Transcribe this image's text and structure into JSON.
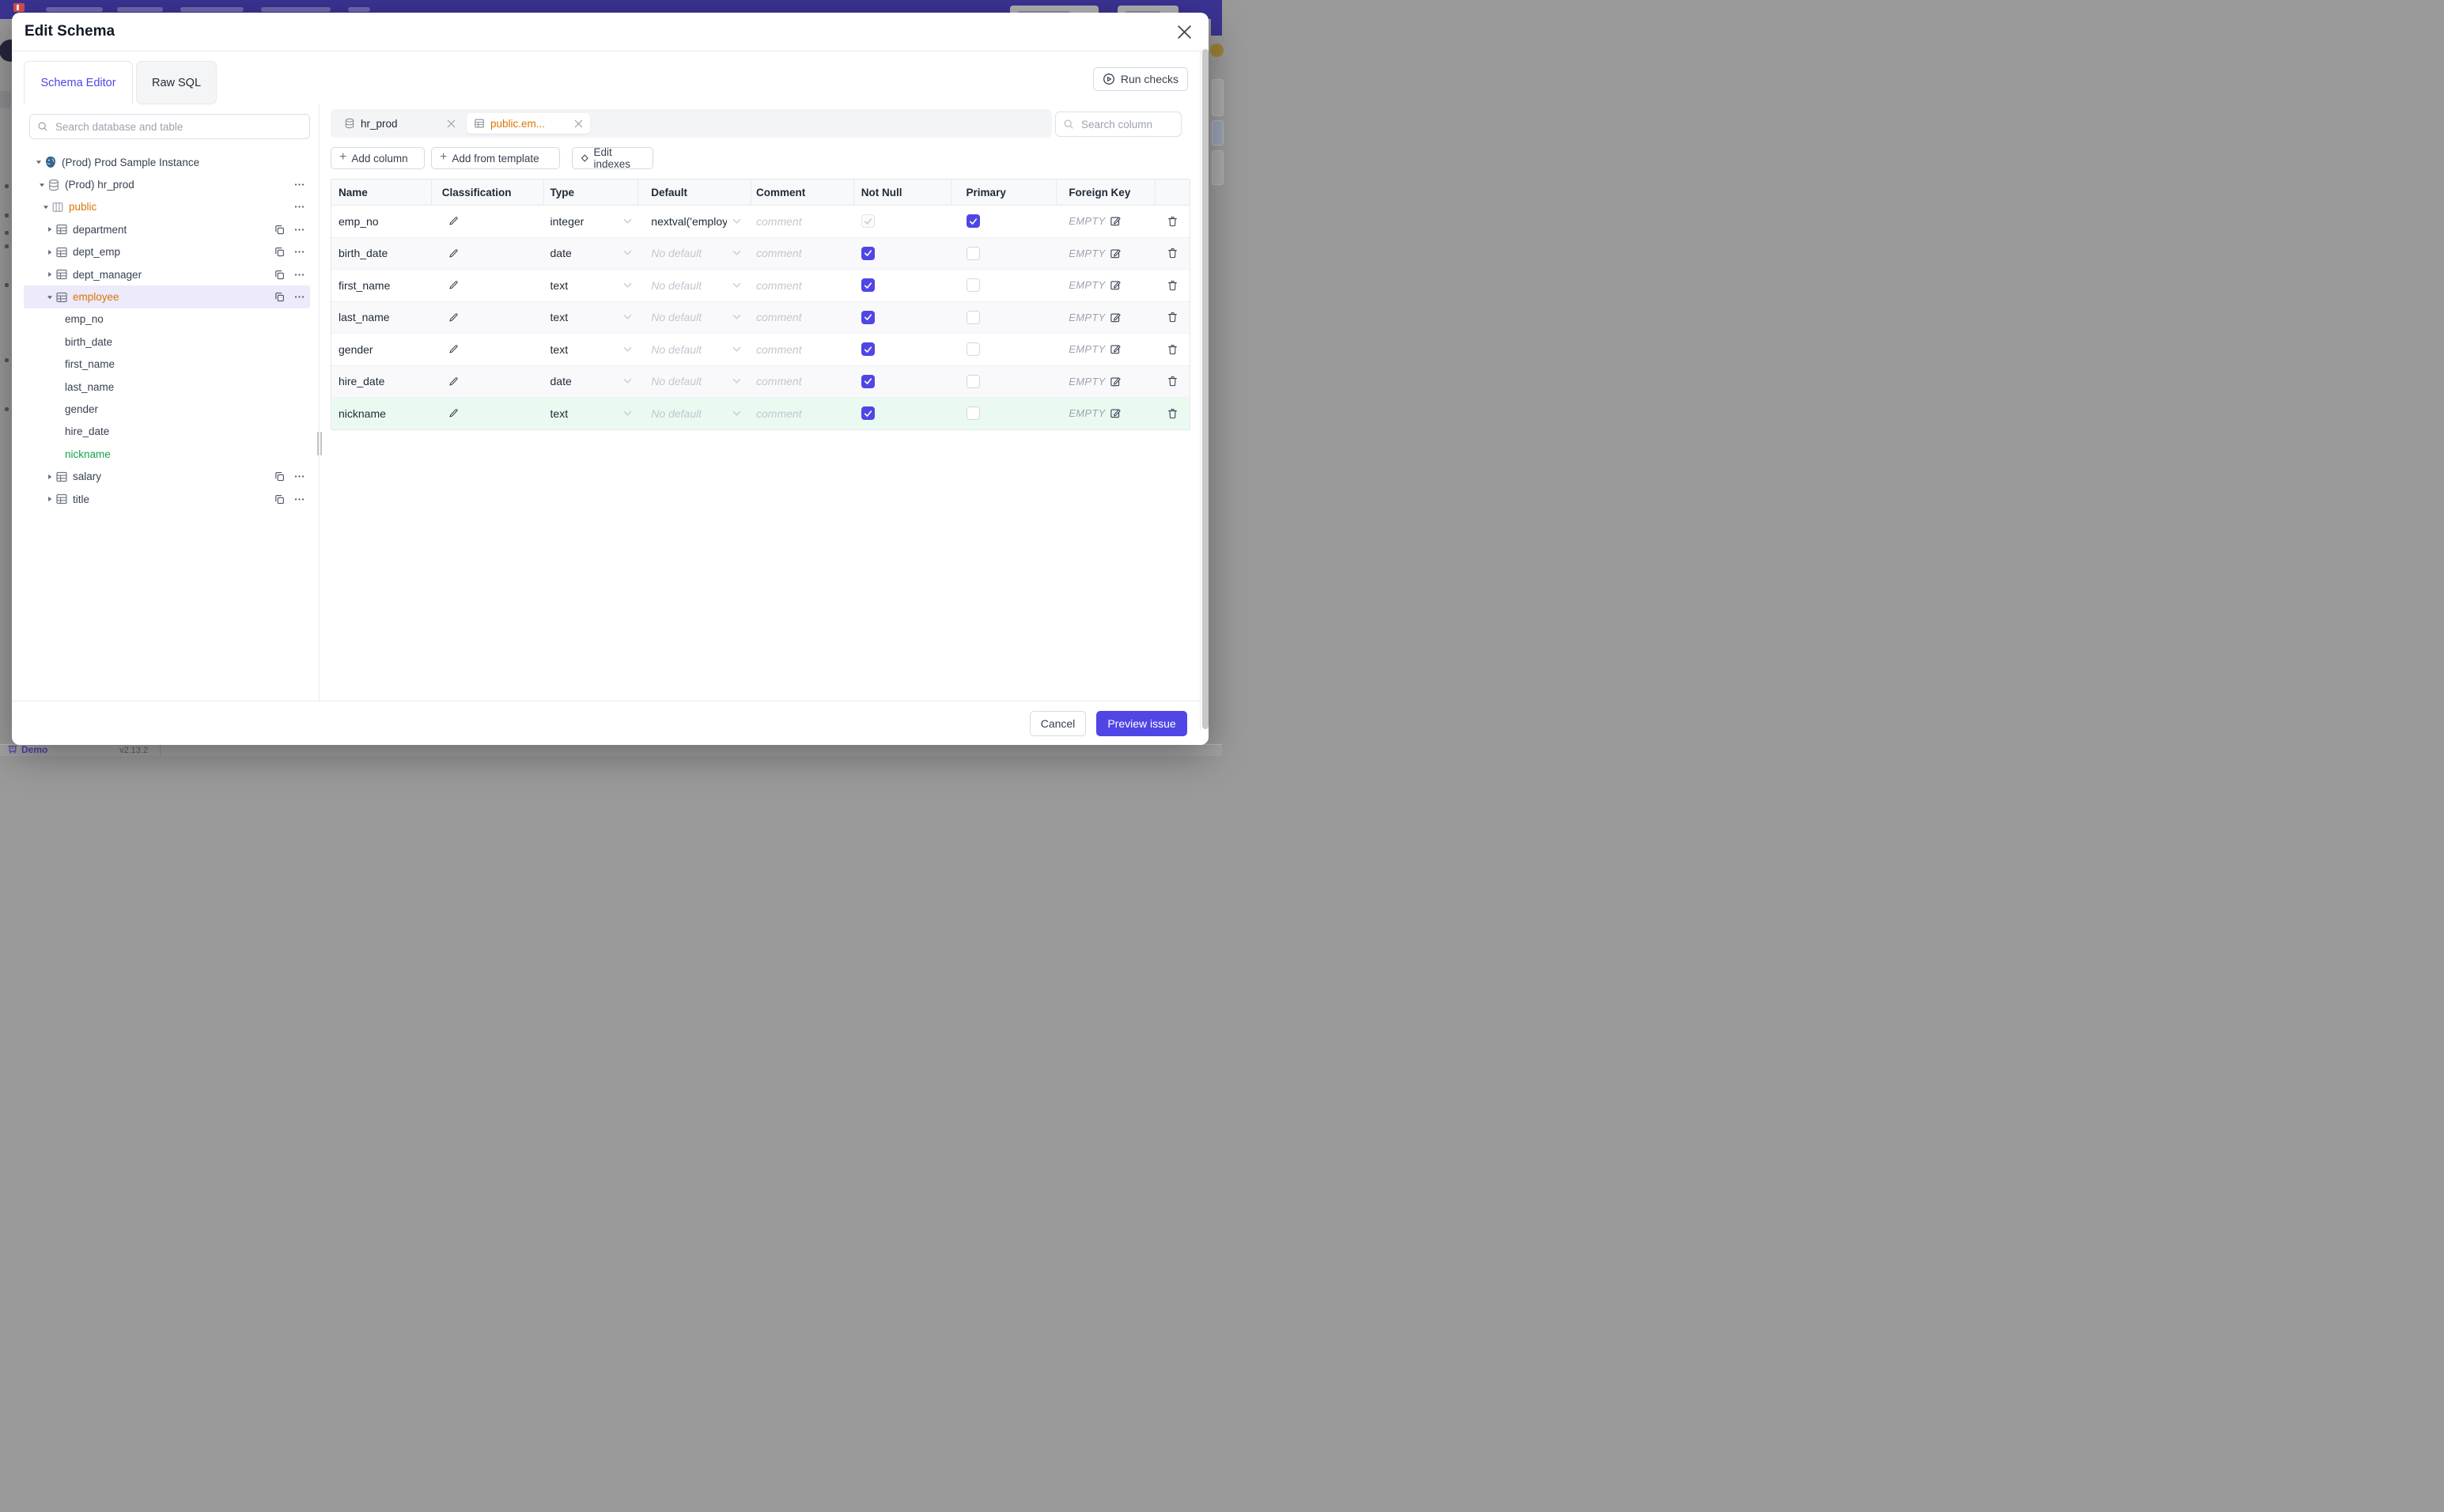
{
  "backdrop": {
    "footer": {
      "demo_label": "Demo",
      "version": "v2.13.2"
    }
  },
  "modal": {
    "title": "Edit Schema",
    "close_icon": "close-icon",
    "tabs": [
      {
        "label": "Schema Editor",
        "active": true
      },
      {
        "label": "Raw SQL",
        "active": false
      }
    ],
    "run_checks_label": "Run checks",
    "sidebar": {
      "search_placeholder": "Search database and table",
      "tree": [
        {
          "level": 0,
          "caret": "down",
          "icon": "postgres-icon",
          "label": "(Prod) Prod Sample Instance"
        },
        {
          "level": 1,
          "caret": "down",
          "icon": "database-icon",
          "label": "(Prod) hr_prod",
          "actions": [
            "more"
          ]
        },
        {
          "level": 2,
          "caret": "down",
          "icon": "schema-icon",
          "label": "public",
          "accent": "amber",
          "actions": [
            "more"
          ]
        },
        {
          "level": 3,
          "caret": "right",
          "icon": "table-icon",
          "label": "department",
          "actions": [
            "copy",
            "more"
          ]
        },
        {
          "level": 3,
          "caret": "right",
          "icon": "table-icon",
          "label": "dept_emp",
          "actions": [
            "copy",
            "more"
          ]
        },
        {
          "level": 3,
          "caret": "right",
          "icon": "table-icon",
          "label": "dept_manager",
          "actions": [
            "copy",
            "more"
          ]
        },
        {
          "level": 3,
          "caret": "down",
          "icon": "table-icon",
          "label": "employee",
          "accent": "amber",
          "selected": true,
          "actions": [
            "copy",
            "more"
          ]
        },
        {
          "level": 4,
          "label": "emp_no"
        },
        {
          "level": 4,
          "label": "birth_date"
        },
        {
          "level": 4,
          "label": "first_name"
        },
        {
          "level": 4,
          "label": "last_name"
        },
        {
          "level": 4,
          "label": "gender"
        },
        {
          "level": 4,
          "label": "hire_date"
        },
        {
          "level": 4,
          "label": "nickname",
          "accent": "green"
        },
        {
          "level": 3,
          "caret": "right",
          "icon": "table-icon",
          "label": "salary",
          "actions": [
            "copy",
            "more"
          ]
        },
        {
          "level": 3,
          "caret": "right",
          "icon": "table-icon",
          "label": "title",
          "actions": [
            "copy",
            "more"
          ]
        }
      ]
    },
    "editor": {
      "chips": [
        {
          "label": "hr_prod",
          "icon": "database-icon",
          "active": false
        },
        {
          "label": "public.em...",
          "icon": "table-icon",
          "active": true,
          "accent": "amber"
        }
      ],
      "search_placeholder": "Search column",
      "actions": [
        {
          "label": "Add column",
          "icon": "plus-icon"
        },
        {
          "label": "Add from template",
          "icon": "plus-icon"
        },
        {
          "label": "Edit indexes",
          "icon": "diamond-icon"
        }
      ],
      "table": {
        "headers": [
          "Name",
          "Classification",
          "Type",
          "Default",
          "Comment",
          "Not Null",
          "Primary",
          "Foreign Key",
          ""
        ],
        "comment_placeholder": "comment",
        "foreign_key_empty": "EMPTY",
        "rows": [
          {
            "name": "emp_no",
            "type": "integer",
            "default": "nextval('employ",
            "default_is_placeholder": false,
            "not_null": true,
            "not_null_disabled": true,
            "primary": true,
            "highlight": false
          },
          {
            "name": "birth_date",
            "type": "date",
            "default": "No default",
            "default_is_placeholder": true,
            "not_null": true,
            "not_null_disabled": false,
            "primary": false,
            "highlight": false
          },
          {
            "name": "first_name",
            "type": "text",
            "default": "No default",
            "default_is_placeholder": true,
            "not_null": true,
            "not_null_disabled": false,
            "primary": false,
            "highlight": false
          },
          {
            "name": "last_name",
            "type": "text",
            "default": "No default",
            "default_is_placeholder": true,
            "not_null": true,
            "not_null_disabled": false,
            "primary": false,
            "highlight": false
          },
          {
            "name": "gender",
            "type": "text",
            "default": "No default",
            "default_is_placeholder": true,
            "not_null": true,
            "not_null_disabled": false,
            "primary": false,
            "highlight": false
          },
          {
            "name": "hire_date",
            "type": "date",
            "default": "No default",
            "default_is_placeholder": true,
            "not_null": true,
            "not_null_disabled": false,
            "primary": false,
            "highlight": false
          },
          {
            "name": "nickname",
            "type": "text",
            "default": "No default",
            "default_is_placeholder": true,
            "not_null": true,
            "not_null_disabled": false,
            "primary": false,
            "highlight": true
          }
        ]
      }
    },
    "footer": {
      "cancel_label": "Cancel",
      "preview_label": "Preview issue"
    },
    "colors": {
      "accent": "#4f46e5",
      "amber": "#d97706",
      "green": "#16a34a",
      "selected_row": "#eceafb",
      "highlight_row": "#eafaf0"
    }
  }
}
